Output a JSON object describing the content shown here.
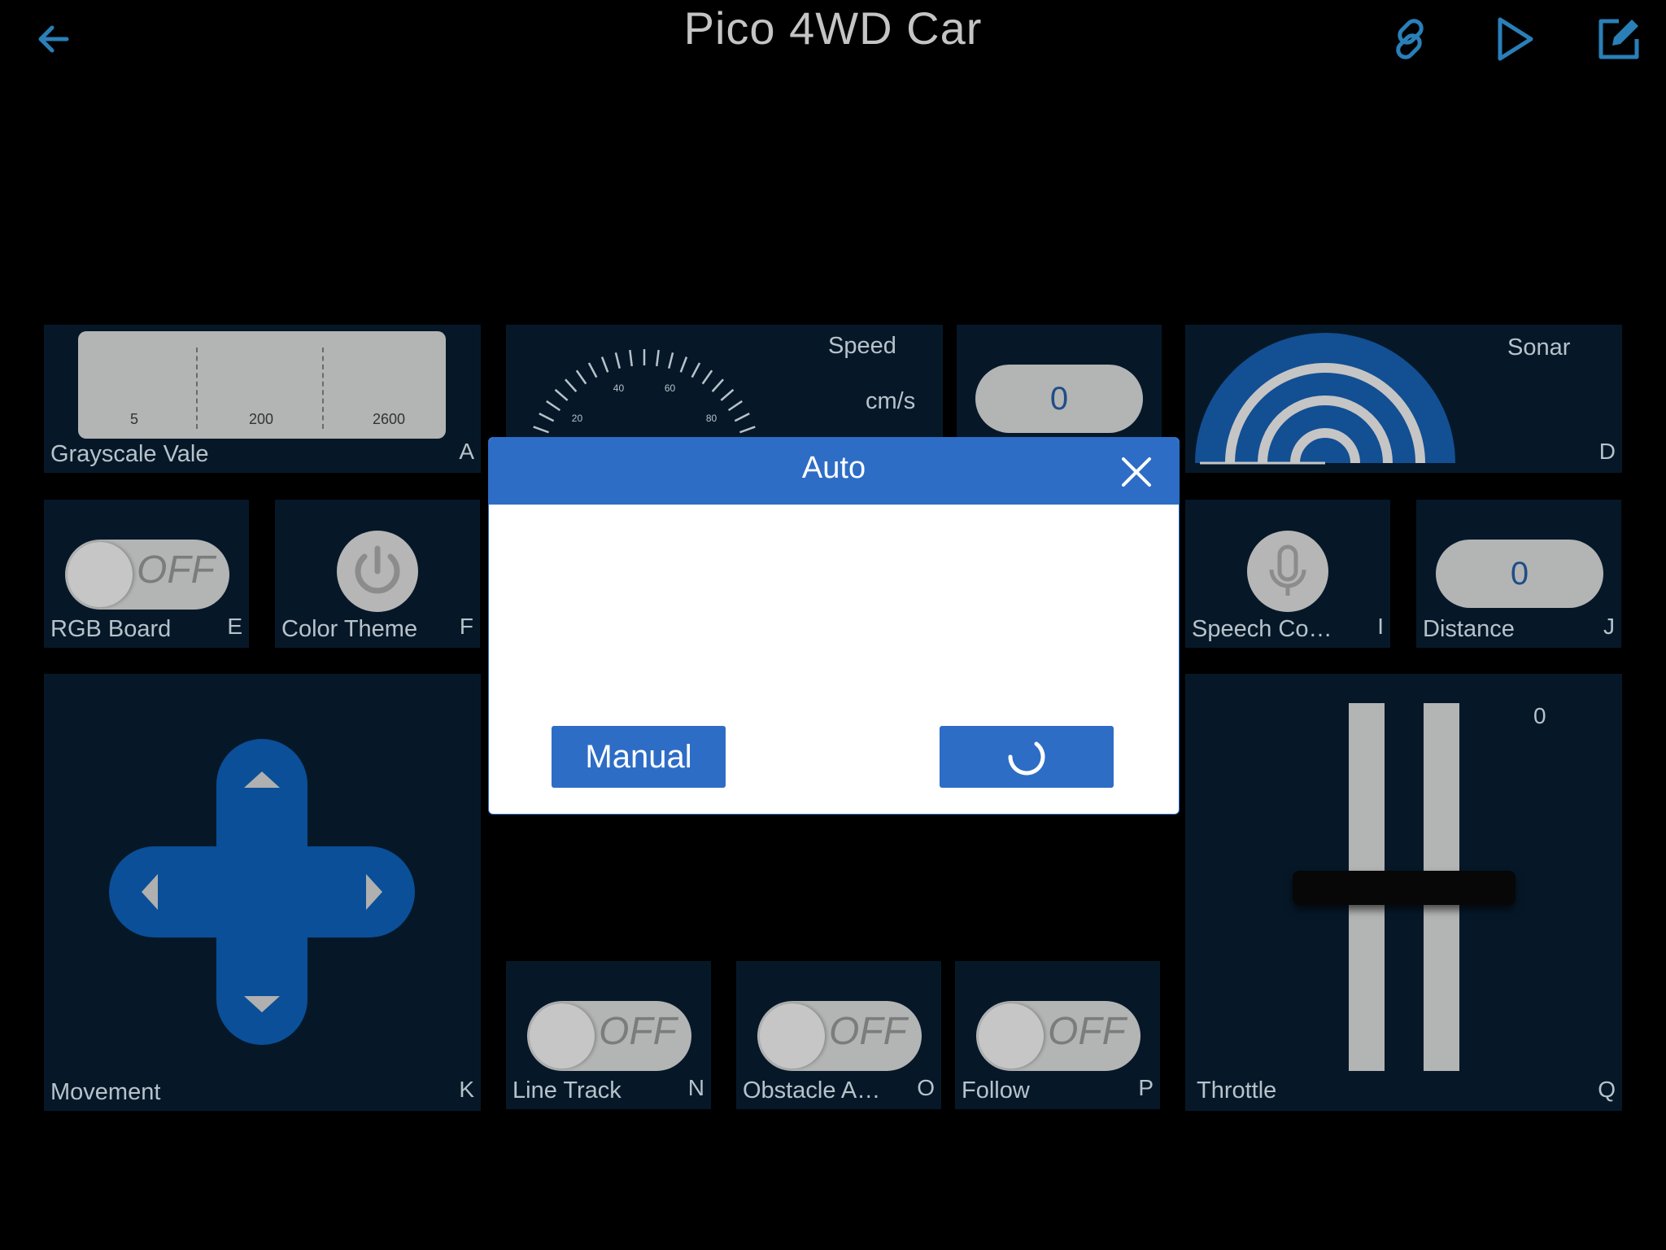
{
  "header": {
    "title": "Pico 4WD Car"
  },
  "widgets": {
    "grayscale": {
      "label": "Grayscale Vale",
      "key": "A",
      "ticks": [
        "5",
        "200",
        "2600"
      ]
    },
    "speed": {
      "title": "Speed",
      "unit": "cm/s",
      "ticks": [
        "20",
        "40",
        "60",
        "80"
      ]
    },
    "speed_value": {
      "value": "0"
    },
    "sonar": {
      "label": "Sonar",
      "key": "D"
    },
    "rgb_board": {
      "label": "RGB Board",
      "key": "E",
      "state": "OFF"
    },
    "color_theme": {
      "label": "Color Theme",
      "key": "F"
    },
    "speech": {
      "label": "Speech Co…",
      "key": "I"
    },
    "distance": {
      "label": "Distance",
      "key": "J",
      "value": "0"
    },
    "movement": {
      "label": "Movement",
      "key": "K"
    },
    "line_track": {
      "label": "Line Track",
      "key": "N",
      "state": "OFF"
    },
    "obstacle": {
      "label": "Obstacle A…",
      "key": "O",
      "state": "OFF"
    },
    "follow": {
      "label": "Follow",
      "key": "P",
      "state": "OFF"
    },
    "throttle": {
      "label": "Throttle",
      "key": "Q",
      "value": "0"
    }
  },
  "dialog": {
    "title": "Auto",
    "manual_label": "Manual"
  },
  "colors": {
    "accent": "#2e6dc6",
    "panel": "#061828",
    "icon": "#2a7fb8"
  }
}
